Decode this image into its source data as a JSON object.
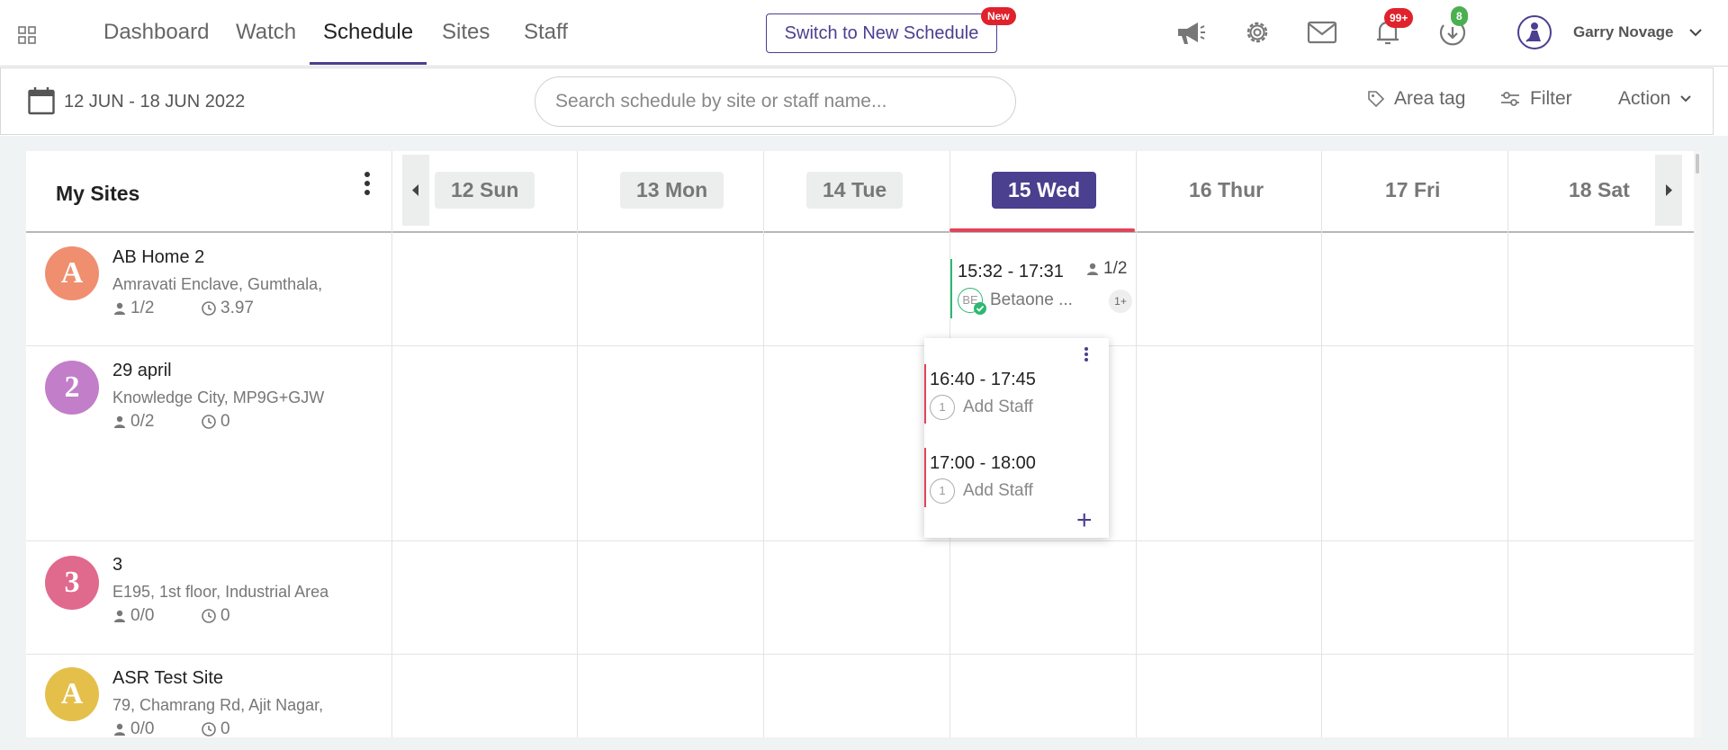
{
  "nav": {
    "tabs": [
      {
        "label": "Dashboard"
      },
      {
        "label": "Watch"
      },
      {
        "label": "Schedule"
      },
      {
        "label": "Sites"
      },
      {
        "label": "Staff"
      }
    ],
    "switch_label": "Switch to New Schedule",
    "new_badge": "New",
    "notifications_count": "99+",
    "downloads_count": "8",
    "user_name": "Garry Novage",
    "icons": [
      "apps-grid-icon",
      "megaphone-icon",
      "gear-icon",
      "mail-icon",
      "bell-icon",
      "download-icon",
      "user-avatar-icon",
      "chevron-down-icon"
    ]
  },
  "toolbar": {
    "date_range": "12 JUN - 18 JUN 2022",
    "search_placeholder": "Search schedule by site or staff name...",
    "area_tag": "Area tag",
    "filter": "Filter",
    "action": "Action"
  },
  "grid": {
    "sidebar_title": "My Sites",
    "days": [
      "12 Sun",
      "13 Mon",
      "14 Tue",
      "15 Wed",
      "16 Thur",
      "17 Fri",
      "18 Sat"
    ],
    "active_day": "15 Wed",
    "sites": [
      {
        "initial": "A",
        "name": "AB Home 2",
        "address": "Amravati Enclave, Gumthala,",
        "staff": "1/2",
        "hours": "3.97",
        "color": "#ef8f70"
      },
      {
        "initial": "2",
        "name": "29 april",
        "address": "Knowledge City, MP9G+GJW",
        "staff": "0/2",
        "hours": "0",
        "color": "#c27ec9"
      },
      {
        "initial": "3",
        "name": "3",
        "address": "E195, 1st floor, Industrial Area",
        "staff": "0/0",
        "hours": "0",
        "color": "#e06a8e"
      },
      {
        "initial": "A",
        "name": "ASR Test Site",
        "address": "79, Chamrang Rd, Ajit Nagar,",
        "staff": "0/0",
        "hours": "0",
        "color": "#e4c04b"
      }
    ],
    "shift_ab": {
      "time": "15:32 - 17:31",
      "staff_count": "1/2",
      "staff_initials": "BE",
      "staff_name": "Betaone ...",
      "more": "1+"
    },
    "popup_shifts": [
      {
        "time": "16:40 - 17:45",
        "count": "1",
        "add_label": "Add Staff"
      },
      {
        "time": "17:00 - 18:00",
        "count": "1",
        "add_label": "Add Staff"
      }
    ],
    "popup_add": "+"
  },
  "colors": {
    "accent": "#4b3f8f",
    "today_bar": "#e0455a",
    "badge_red": "#e0222c",
    "badge_green": "#4caf50",
    "confirmed_green": "#2eb872",
    "unfilled_red": "#e0455a"
  }
}
